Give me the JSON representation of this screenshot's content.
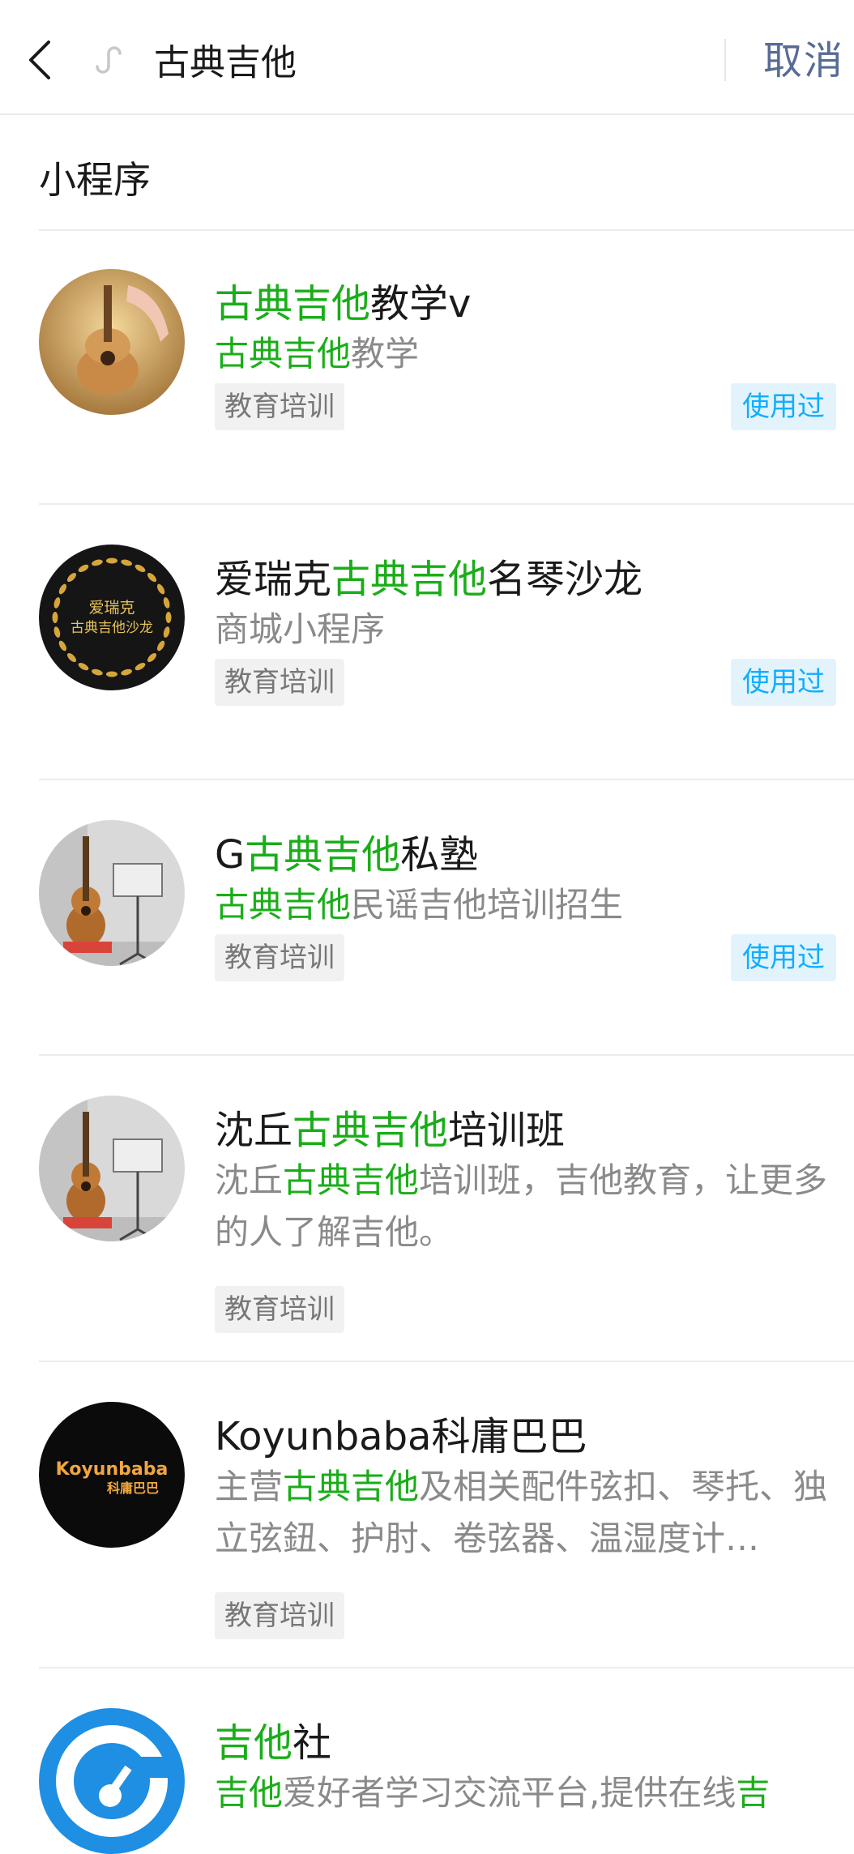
{
  "search": {
    "query": "古典吉他",
    "cancel_label": "取消"
  },
  "section": {
    "title": "小程序"
  },
  "results": [
    {
      "title": [
        {
          "t": "古典吉他",
          "h": true
        },
        {
          "t": "教学v",
          "h": false
        }
      ],
      "desc": [
        {
          "t": "古典吉他",
          "h": true
        },
        {
          "t": "教学",
          "h": false
        }
      ],
      "tag": "教育培训",
      "used": "使用过",
      "avatar": "guitar-photo"
    },
    {
      "title": [
        {
          "t": "爱瑞克",
          "h": false
        },
        {
          "t": "古典吉他",
          "h": true
        },
        {
          "t": "名琴沙龙",
          "h": false
        }
      ],
      "desc": [
        {
          "t": "商城小程序",
          "h": false
        }
      ],
      "tag": "教育培训",
      "used": "使用过",
      "avatar": "salon-badge",
      "logo_text": [
        "爱瑞克",
        "古典吉他沙龙"
      ]
    },
    {
      "title": [
        {
          "t": "G",
          "h": false
        },
        {
          "t": "古典吉他",
          "h": true
        },
        {
          "t": "私塾",
          "h": false
        }
      ],
      "desc": [
        {
          "t": "古典吉他",
          "h": true
        },
        {
          "t": "民谣吉他培训招生",
          "h": false
        }
      ],
      "tag": "教育培训",
      "used": "使用过",
      "avatar": "guitar-stand-photo"
    },
    {
      "title": [
        {
          "t": "沈丘",
          "h": false
        },
        {
          "t": "古典吉他",
          "h": true
        },
        {
          "t": "培训班",
          "h": false
        }
      ],
      "desc": [
        {
          "t": "沈丘",
          "h": false
        },
        {
          "t": "古典吉他",
          "h": true
        },
        {
          "t": "培训班，吉他教育，让更多的人了解吉他。",
          "h": false
        }
      ],
      "tag": "教育培训",
      "used": "",
      "avatar": "guitar-stand-photo"
    },
    {
      "title": [
        {
          "t": "Koyunbaba科庸巴巴",
          "h": false
        }
      ],
      "desc": [
        {
          "t": "主营",
          "h": false
        },
        {
          "t": "古典吉他",
          "h": true
        },
        {
          "t": "及相关配件弦扣、琴托、独立弦鈕、护肘、卷弦器、温湿度计…",
          "h": false
        }
      ],
      "tag": "教育培训",
      "used": "",
      "avatar": "koyunbaba-logo",
      "logo_text": [
        "Koyunbaba",
        "科庸巴巴"
      ]
    },
    {
      "title": [
        {
          "t": "吉他",
          "h": true
        },
        {
          "t": "社",
          "h": false
        }
      ],
      "desc": [
        {
          "t": "吉他",
          "h": true
        },
        {
          "t": "爱好者学习交流平台,提供在线",
          "h": false
        },
        {
          "t": "吉",
          "h": true
        }
      ],
      "tag": "",
      "used": "",
      "avatar": "guitar-club-logo"
    }
  ]
}
